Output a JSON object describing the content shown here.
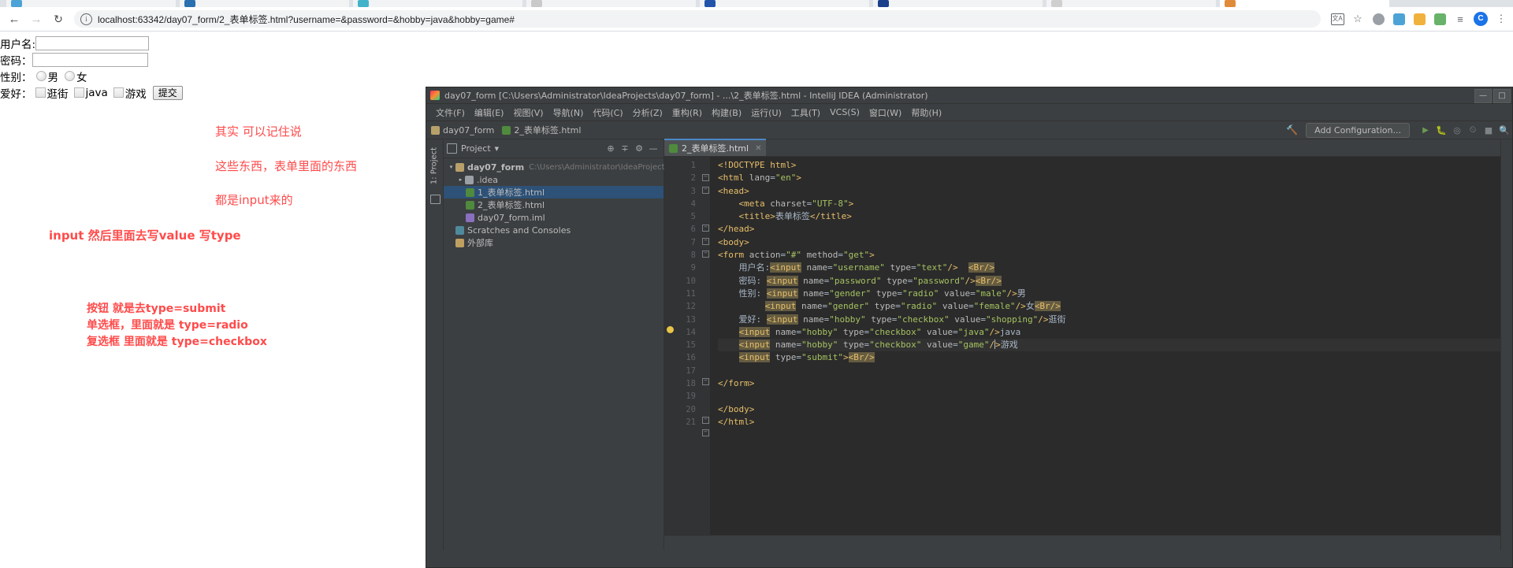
{
  "browser": {
    "tabs": [
      {
        "title": "",
        "color": "#4da3d6",
        "active": false
      },
      {
        "title": "",
        "color": "#2a6fb0",
        "active": false
      },
      {
        "title": "",
        "color": "#43b3c9",
        "active": false
      },
      {
        "title": "",
        "color": "#c9c9c9",
        "active": false
      },
      {
        "title": "",
        "color": "#2255aa",
        "active": false
      },
      {
        "title": "",
        "color": "#1b3f8b",
        "active": false
      },
      {
        "title": "",
        "color": "#cfcfcf",
        "active": false
      },
      {
        "title": "",
        "color": "#e08b3a",
        "active": true
      }
    ],
    "back_icon": "back-arrow-icon",
    "forward_icon": "forward-arrow-icon",
    "reload_icon": "reload-icon",
    "info_icon": "info-icon",
    "url": "localhost:63342/day07_form/2_表单标签.html?username=&password=&hobby=java&hobby=game#",
    "translate_icon_label": "文A",
    "star_icon": "bookmark-star-icon",
    "profile_initial": "C",
    "menu_icon": "browser-menu-icon"
  },
  "form": {
    "username": {
      "label": "用户名:",
      "value": "",
      "placeholder": ""
    },
    "password": {
      "label": "密码：",
      "value": "",
      "placeholder": ""
    },
    "gender": {
      "label": "性别：",
      "options": [
        {
          "label": "男",
          "value": "male",
          "checked": false
        },
        {
          "label": "女",
          "value": "female",
          "checked": false
        }
      ]
    },
    "hobby": {
      "label": "爱好：",
      "options": [
        {
          "label": "逛街",
          "value": "shopping",
          "checked": false
        },
        {
          "label": "java",
          "value": "java",
          "checked": false
        },
        {
          "label": "游戏",
          "value": "game",
          "checked": false
        }
      ]
    },
    "submit_label": "提交"
  },
  "notes": {
    "n1": "其实 可以记住说",
    "n2": "这些东西，表单里面的东西",
    "n3": "都是input来的",
    "n4": "input  然后里面去写value 写type",
    "n5": "按钮 就是去type=submit",
    "n6": "单选框，里面就是 type=radio",
    "n7": "复选框 里面就是 type=checkbox",
    "color": "#ff4b4b"
  },
  "idea": {
    "window_title": "day07_form [C:\\Users\\Administrator\\IdeaProjects\\day07_form] - ...\\2_表单标签.html - IntelliJ IDEA (Administrator)",
    "window_controls": [
      "—",
      "□",
      "✕"
    ],
    "menus": [
      "文件(F)",
      "编辑(E)",
      "视图(V)",
      "导航(N)",
      "代码(C)",
      "分析(Z)",
      "重构(R)",
      "构建(B)",
      "运行(U)",
      "工具(T)",
      "VCS(S)",
      "窗口(W)",
      "帮助(H)"
    ],
    "breadcrumb": [
      {
        "label": "day07_form",
        "icon": "project-module-icon"
      },
      {
        "label": "2_表单标签.html",
        "icon": "html-file-icon"
      }
    ],
    "toolbar": {
      "build_icon": "hammer-icon",
      "add_configuration": "Add Configuration...",
      "icons": [
        "run-icon",
        "debug-icon",
        "coverage-icon",
        "profile-icon",
        "stop-icon",
        "search-everywhere-icon"
      ]
    },
    "left_tool_strip": {
      "tab": "1: Project",
      "structure_icon": "structure-icon"
    },
    "project_panel": {
      "title": "Project",
      "chevron": "▾",
      "header_icons": [
        "locate-icon",
        "collapse-all-icon",
        "settings-gear-icon",
        "hide-icon"
      ],
      "tree": [
        {
          "label": "day07_form",
          "path": "C:\\Users\\Administrator\\IdeaProject",
          "icon": "project",
          "arrow": "▾",
          "indent": 0,
          "bold": true,
          "selected": false
        },
        {
          "label": ".idea",
          "path": "",
          "icon": "folder",
          "arrow": "▸",
          "indent": 1,
          "bold": false,
          "selected": false
        },
        {
          "label": "1_表单标签.html",
          "path": "",
          "icon": "html",
          "arrow": "",
          "indent": 2,
          "bold": false,
          "selected": true
        },
        {
          "label": "2_表单标签.html",
          "path": "",
          "icon": "html",
          "arrow": "",
          "indent": 2,
          "bold": false,
          "selected": false
        },
        {
          "label": "day07_form.iml",
          "path": "",
          "icon": "iml",
          "arrow": "",
          "indent": 2,
          "bold": false,
          "selected": false
        },
        {
          "label": "Scratches and Consoles",
          "path": "",
          "icon": "scratch",
          "arrow": "",
          "indent": 0,
          "bold": false,
          "selected": false
        },
        {
          "label": "外部库",
          "path": "",
          "icon": "lib",
          "arrow": "",
          "indent": 0,
          "bold": false,
          "selected": false
        }
      ]
    },
    "editor_tab": {
      "label": "2_表单标签.html",
      "icon": "html-file-icon",
      "close": "✕"
    },
    "code": {
      "line_numbers": [
        1,
        2,
        3,
        4,
        5,
        6,
        7,
        8,
        9,
        10,
        11,
        12,
        13,
        14,
        15,
        16,
        17,
        18,
        19,
        20,
        21
      ],
      "lines": [
        "<!DOCTYPE html>",
        "<html lang=\"en\">",
        "<head>",
        "    <meta charset=\"UTF-8\">",
        "    <title>表单标签</title>",
        "</head>",
        "<body>",
        "<form action=\"#\" method=\"get\">",
        "    用户名:<input name=\"username\" type=\"text\"/>  <Br/>",
        "    密码: <input name=\"password\" type=\"password\"/><Br/>",
        "    性别: <input name=\"gender\" type=\"radio\" value=\"male\"/>男",
        "         <input name=\"gender\" type=\"radio\" value=\"female\"/>女<Br/>",
        "    爱好: <input name=\"hobby\" type=\"checkbox\" value=\"shopping\"/>逛街",
        "    <input name=\"hobby\" type=\"checkbox\" value=\"java\"/>java",
        "    <input name=\"hobby\" type=\"checkbox\" value=\"game\"/>游戏",
        "    <input type=\"submit\"><Br/>",
        "",
        "</form>",
        "",
        "</body>",
        "</html>"
      ]
    }
  }
}
